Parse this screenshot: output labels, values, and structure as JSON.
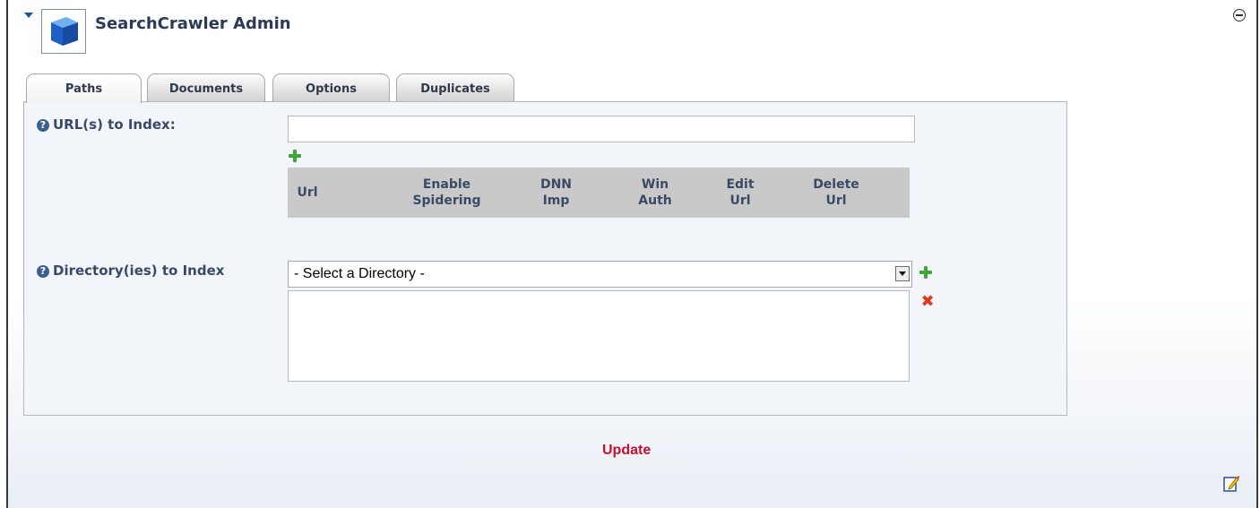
{
  "module": {
    "title": "SearchCrawler Admin",
    "icon": "cube-icon"
  },
  "tabs": [
    {
      "label": "Paths",
      "active": true
    },
    {
      "label": "Documents",
      "active": false
    },
    {
      "label": "Options",
      "active": false
    },
    {
      "label": "Duplicates",
      "active": false
    }
  ],
  "urls": {
    "label": "URL(s) to Index:",
    "input_value": "",
    "grid_columns": [
      {
        "line1": "Url",
        "line2": ""
      },
      {
        "line1": "Enable",
        "line2": "Spidering"
      },
      {
        "line1": "DNN",
        "line2": "Imp"
      },
      {
        "line1": "Win",
        "line2": "Auth"
      },
      {
        "line1": "Edit",
        "line2": "Url"
      },
      {
        "line1": "Delete",
        "line2": "Url"
      }
    ]
  },
  "directories": {
    "label": "Directory(ies) to Index",
    "select_value": "- Select a Directory -"
  },
  "actions": {
    "update_label": "Update"
  },
  "colors": {
    "accent": "#c8102e",
    "title": "#2b3a55",
    "add": "#3fa63a",
    "delete": "#e03a1e"
  }
}
